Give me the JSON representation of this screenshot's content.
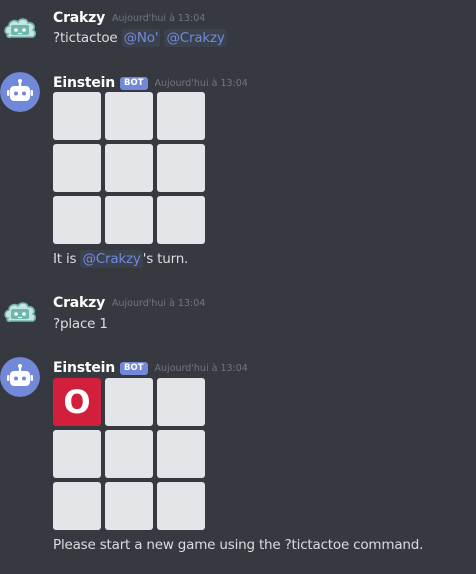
{
  "messages": [
    {
      "author": "Crakzy",
      "timestamp": "Aujourd'hui à 13:04",
      "text_prefix": "?tictactoe",
      "mention_1": "@No'",
      "mention_2": "@Crakzy"
    },
    {
      "author": "Einstein",
      "bot_tag": "BOT",
      "timestamp": "Aujourd'hui à 13:04",
      "board": [
        "",
        "",
        "",
        "",
        "",
        "",
        "",
        "",
        ""
      ],
      "text_before": "It is",
      "mention": "@Crakzy",
      "text_after": "'s turn."
    },
    {
      "author": "Crakzy",
      "timestamp": "Aujourd'hui à 13:04",
      "text": "?place 1"
    },
    {
      "author": "Einstein",
      "bot_tag": "BOT",
      "timestamp": "Aujourd'hui à 13:04",
      "board": [
        "O",
        "",
        "",
        "",
        "",
        "",
        "",
        "",
        ""
      ],
      "text": "Please start a new game using the ?tictactoe command."
    }
  ],
  "colors": {
    "background": "#36393f",
    "mention": "#7289da",
    "bot_tag": "#7289da",
    "bot_avatar": "#7289da",
    "user_avatar_bg": "#2f3136",
    "cell": "#e3e5e8",
    "o_cell": "#d21f3c"
  },
  "icons": {
    "user_avatar": "cloud-face-icon",
    "bot_avatar": "robot-icon"
  }
}
